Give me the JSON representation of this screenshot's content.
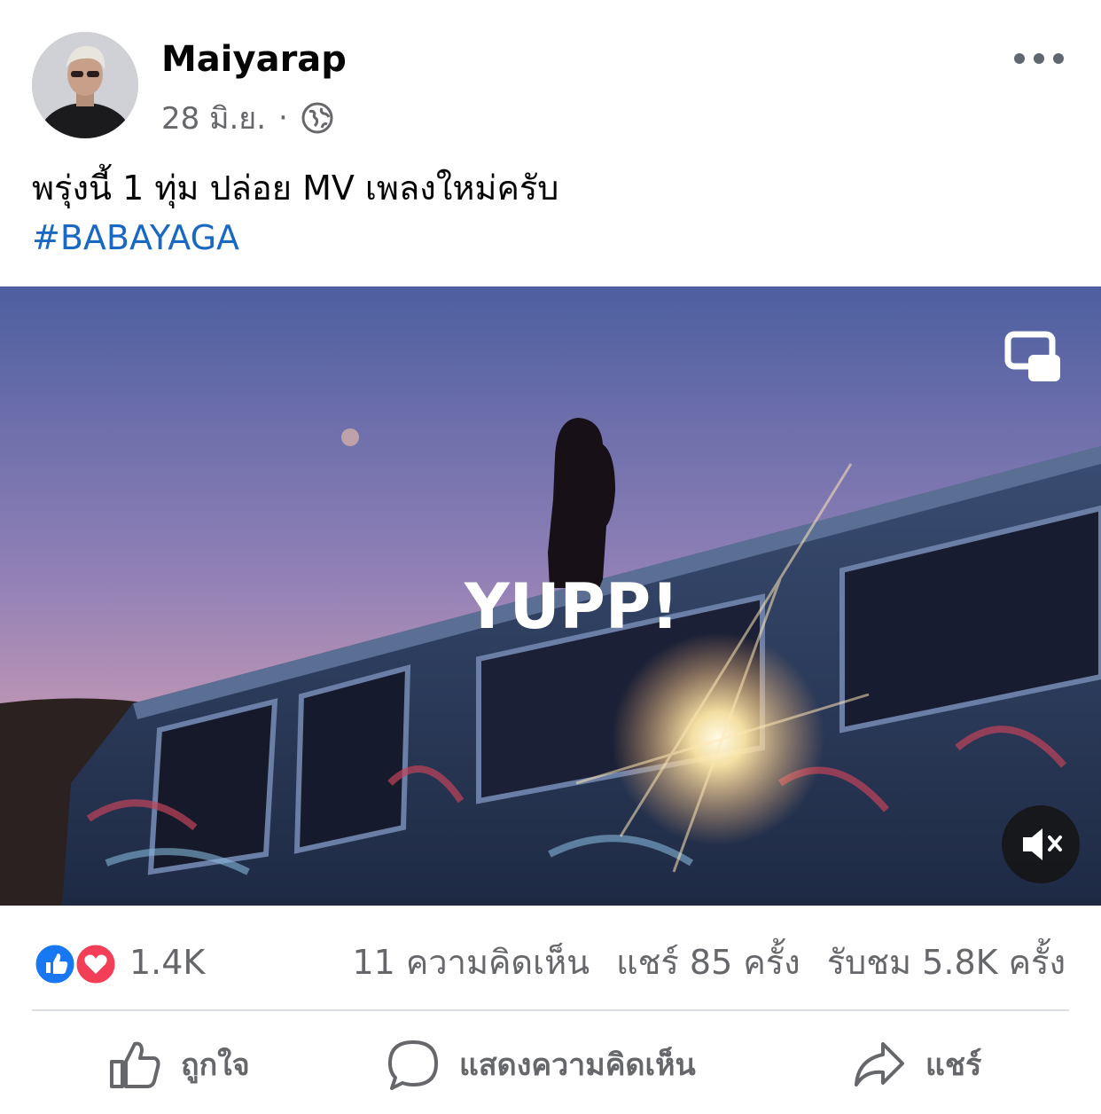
{
  "post": {
    "author": "Maiyarap",
    "date": "28 มิ.ย.",
    "separator": "·",
    "privacy_icon": "globe-icon",
    "text": "พรุ่งนี้ 1 ทุ่ม ปล่อย MV เพลงใหม่ครับ",
    "hashtag": "#BABAYAGA"
  },
  "video": {
    "watermark": "YUPP!",
    "pip_icon": "picture-in-picture-icon",
    "mute_icon": "speaker-muted-icon"
  },
  "stats": {
    "reaction_icons": [
      "like-reaction-icon",
      "love-reaction-icon"
    ],
    "reactions": "1.4K",
    "comments": "11 ความคิดเห็น",
    "shares": "แชร์ 85 ครั้ง",
    "views": "รับชม 5.8K ครั้ง"
  },
  "actions": {
    "like": "ถูกใจ",
    "comment": "แสดงความคิดเห็น",
    "share": "แชร์"
  },
  "colors": {
    "primary_text": "#050505",
    "secondary_text": "#65676b",
    "hashtag": "#1868c4",
    "like_blue": "#1877f2",
    "love_red": "#f33e58"
  }
}
